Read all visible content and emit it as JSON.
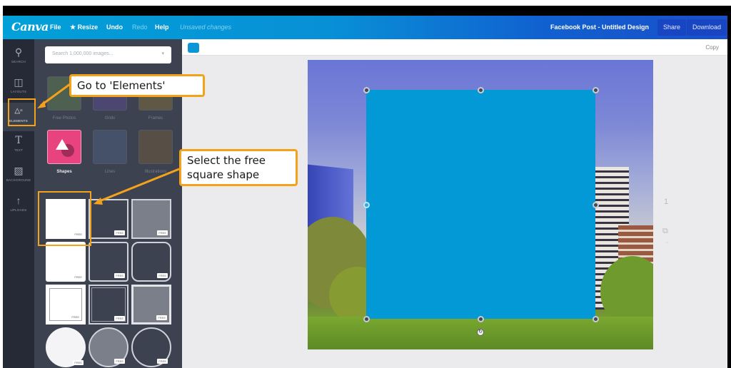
{
  "app": {
    "logo": "Canva",
    "menu": {
      "file": "File",
      "resize": "Resize",
      "undo": "Undo",
      "redo": "Redo",
      "help": "Help",
      "status": "Unsaved changes"
    },
    "document_title": "Facebook Post - Untitled Design",
    "share_label": "Share",
    "download_label": "Download"
  },
  "rail": {
    "items": [
      {
        "label": "SEARCH",
        "icon": "search-icon"
      },
      {
        "label": "LAYOUTS",
        "icon": "layouts-icon"
      },
      {
        "label": "ELEMENTS",
        "icon": "elements-icon",
        "active": true
      },
      {
        "label": "TEXT",
        "icon": "text-icon"
      },
      {
        "label": "BACKGROUND",
        "icon": "background-icon"
      },
      {
        "label": "UPLOADS",
        "icon": "upload-icon"
      }
    ]
  },
  "panel": {
    "search_placeholder": "Search 1,000,000 images...",
    "categories": [
      {
        "label": "Free Photos"
      },
      {
        "label": "Grids"
      },
      {
        "label": "Frames"
      },
      {
        "label": "Shapes"
      },
      {
        "label": "Lines"
      },
      {
        "label": "Illustrations"
      }
    ],
    "shapes": [
      {
        "badge": "FREE",
        "style": "white-square"
      },
      {
        "badge": "FREE",
        "style": "outline-square"
      },
      {
        "badge": "FREE",
        "style": "gray-square"
      },
      {
        "badge": "FREE",
        "style": "white-rounded"
      },
      {
        "badge": "FREE",
        "style": "outline-rounded"
      },
      {
        "badge": "FREE",
        "style": "outline-rounded-big"
      },
      {
        "badge": "FREE",
        "style": "white-frame"
      },
      {
        "badge": "FREE",
        "style": "double-outline"
      },
      {
        "badge": "FREE",
        "style": "gray-frame"
      },
      {
        "badge": "FREE",
        "style": "white-circle"
      },
      {
        "badge": "FREE",
        "style": "gray-circle"
      },
      {
        "badge": "FREE",
        "style": "outline-circle"
      }
    ]
  },
  "editor": {
    "selected_color": "#0b96d6",
    "copy_label": "Copy",
    "page_number": "1",
    "shape_fill": "#0399d6"
  },
  "annotations": {
    "callout_elements": "Go to 'Elements'",
    "callout_shape": "Select the free square shape",
    "accent": "#f4a21b"
  }
}
